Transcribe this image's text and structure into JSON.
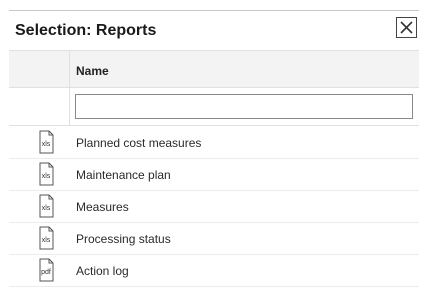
{
  "dialog": {
    "title": "Selection: Reports",
    "close_icon": "close-icon"
  },
  "table": {
    "column_header": "Name",
    "filter": {
      "value": "",
      "placeholder": ""
    },
    "rows": [
      {
        "icon_text": "xls",
        "label": "Planned cost measures"
      },
      {
        "icon_text": "xls",
        "label": "Maintenance plan"
      },
      {
        "icon_text": "xls",
        "label": "Measures"
      },
      {
        "icon_text": "xls",
        "label": "Processing status"
      },
      {
        "icon_text": "pdf",
        "label": "Action log"
      }
    ]
  }
}
